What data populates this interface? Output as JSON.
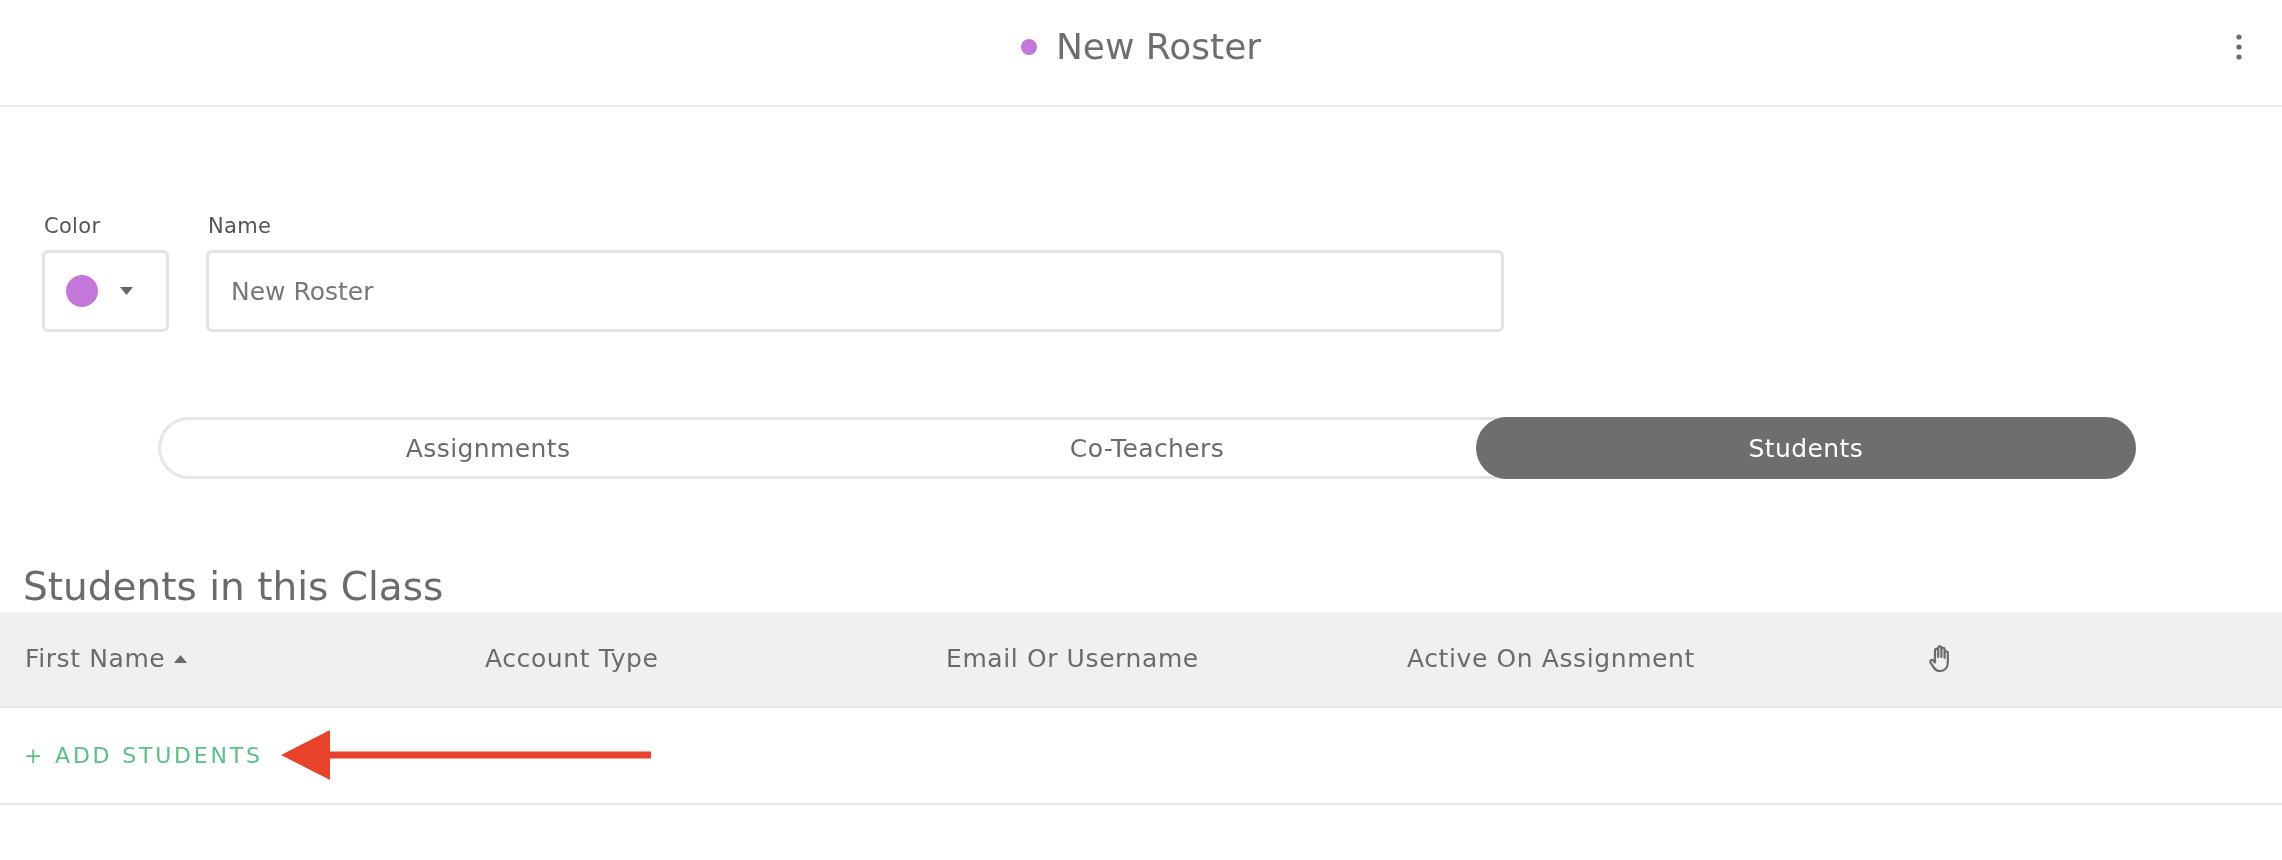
{
  "header": {
    "title": "New Roster",
    "color": "#c377da"
  },
  "form": {
    "color": {
      "label": "Color",
      "color": "#c377da"
    },
    "name": {
      "label": "Name",
      "value": "New Roster"
    }
  },
  "tabs": [
    {
      "label": "Assignments",
      "selected": false
    },
    {
      "label": "Co-Teachers",
      "selected": false
    },
    {
      "label": "Students",
      "selected": true
    }
  ],
  "students": {
    "title": "Students in this Class",
    "columns": [
      {
        "kind": "text",
        "label": "First Name",
        "sorted": true
      },
      {
        "kind": "text",
        "label": "Account Type",
        "sorted": false
      },
      {
        "kind": "text",
        "label": "Email Or Username",
        "sorted": false
      },
      {
        "kind": "text",
        "label": "Active On Assignment",
        "sorted": false
      },
      {
        "kind": "icon",
        "sorted": false
      }
    ],
    "add_button": {
      "label": "+ ADD STUDENTS"
    }
  }
}
